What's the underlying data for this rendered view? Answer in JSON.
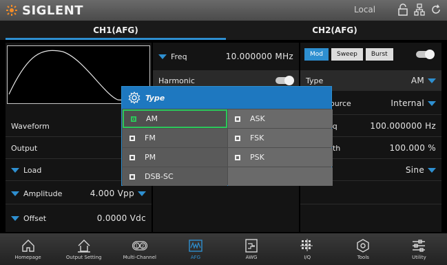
{
  "topbar": {
    "brand": "SIGLENT",
    "status": "Local"
  },
  "tabs": [
    {
      "label": "CH1(AFG)",
      "active": true
    },
    {
      "label": "CH2(AFG)",
      "active": false
    }
  ],
  "left": {
    "waveform_label": "Waveform",
    "waveform_value": "S",
    "output_label": "Output",
    "load_label": "Load",
    "amplitude_label": "Amplitude",
    "amplitude_value": "4.000 Vpp",
    "offset_label": "Offset",
    "offset_value": "0.0000 Vdc"
  },
  "mid": {
    "freq_label": "Freq",
    "freq_value": "10.000000 MHz",
    "harmonic_label": "Harmonic"
  },
  "right": {
    "mode_buttons": [
      "Mod",
      "Sweep",
      "Burst"
    ],
    "type_label": "Type",
    "type_value": "AM",
    "source_label": "Source",
    "source_value": "Internal",
    "freq_label": "eq",
    "freq_value": "100.000000 Hz",
    "depth_label": "pth",
    "depth_value": "100.000 %",
    "shape_value": "Sine"
  },
  "modal": {
    "title": "Type",
    "options": [
      "AM",
      "ASK",
      "FM",
      "FSK",
      "PM",
      "PSK",
      "DSB-SC"
    ],
    "selected": "AM"
  },
  "bottom_nav": [
    {
      "label": "Homepage",
      "icon": "home-icon"
    },
    {
      "label": "Output Setting",
      "icon": "output-icon"
    },
    {
      "label": "Multi-Channel",
      "icon": "multi-channel-icon"
    },
    {
      "label": "AFG",
      "icon": "afg-icon",
      "active": true
    },
    {
      "label": "AWG",
      "icon": "awg-icon"
    },
    {
      "label": "I/Q",
      "icon": "iq-icon"
    },
    {
      "label": "Tools",
      "icon": "tools-icon"
    },
    {
      "label": "Utility",
      "icon": "utility-icon"
    }
  ],
  "colors": {
    "accent": "#2e8fd0",
    "selected": "#2bc85a",
    "brand": "#f28c28"
  }
}
